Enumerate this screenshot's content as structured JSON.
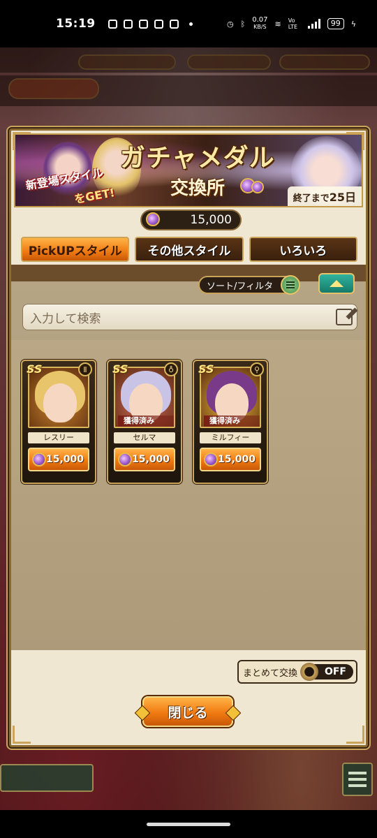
{
  "status_bar": {
    "time": "15:19",
    "net_speed_value": "0.07",
    "net_speed_unit": "KB/S",
    "volte": "Vo LTE",
    "battery": "99"
  },
  "banner": {
    "title": "ガチャメダル",
    "subtitle": "交換所",
    "promo_line1": "新登場スタイル",
    "promo_line2": "をGET!",
    "deadline_prefix": "終了まで",
    "deadline_value": "25日"
  },
  "balance": {
    "amount": "15,000"
  },
  "tabs": [
    {
      "label": "PickUPスタイル",
      "active": true
    },
    {
      "label": "その他スタイル",
      "active": false
    },
    {
      "label": "いろいろ",
      "active": false
    }
  ],
  "sort": {
    "label": "ソート/フィルタ"
  },
  "search": {
    "placeholder": "入力して検索"
  },
  "cards": [
    {
      "name": "レスリー",
      "price": "15,000",
      "rank": "SS",
      "owned_label": "",
      "hair_color": "#e8c46a",
      "bg_color": "#c8842a"
    },
    {
      "name": "セルマ",
      "price": "15,000",
      "rank": "SS",
      "owned_label": "獲得済み",
      "hair_color": "#c9c4e6",
      "bg_color": "#d06a5a"
    },
    {
      "name": "ミルフィー",
      "price": "15,000",
      "rank": "SS",
      "owned_label": "獲得済み",
      "hair_color": "#7a3a8a",
      "bg_color": "#e8b83a"
    }
  ],
  "bulk_exchange": {
    "label": "まとめて交換",
    "state": "OFF"
  },
  "close_button": {
    "label": "閉じる"
  },
  "colors": {
    "accent_orange": "#f07a12",
    "frame_gold": "#c9a45a",
    "panel_cream": "#efe7d2"
  }
}
